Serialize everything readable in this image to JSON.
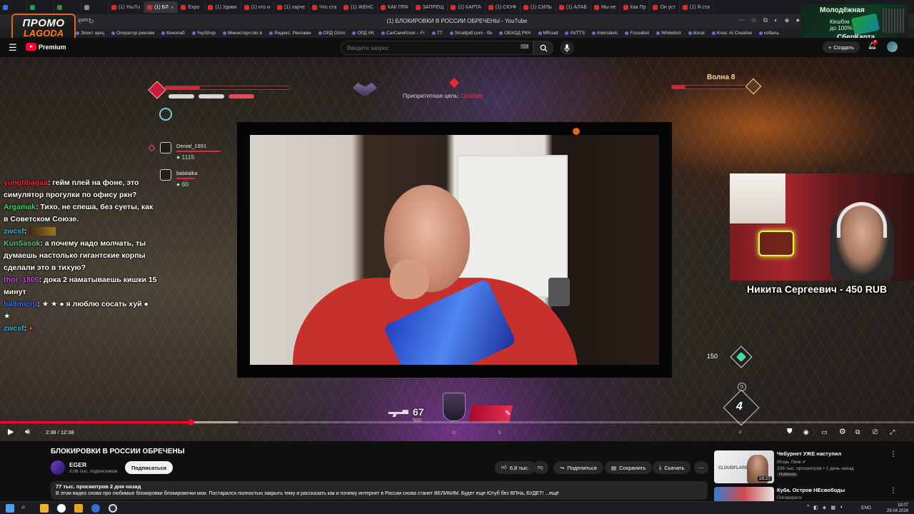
{
  "browser": {
    "tabs": [
      {
        "label": "",
        "active": false
      },
      {
        "label": "",
        "active": false
      },
      {
        "label": "",
        "active": false
      },
      {
        "label": "",
        "active": false
      },
      {
        "label": "(1) YouTu",
        "active": false
      },
      {
        "label": "(1) БЛ",
        "active": true
      },
      {
        "label": "Expo",
        "active": false
      },
      {
        "label": "(1) Удиви",
        "active": false
      },
      {
        "label": "(1) кто и",
        "active": false
      },
      {
        "label": "(1) харче",
        "active": false
      },
      {
        "label": "Что ста",
        "active": false
      },
      {
        "label": "(1) ЖЕНС",
        "active": false
      },
      {
        "label": "КАК ПРА",
        "active": false
      },
      {
        "label": "ЗАПРЕЩ",
        "active": false
      },
      {
        "label": "(1) КАРТА",
        "active": false
      },
      {
        "label": "(1) СКУФ",
        "active": false
      },
      {
        "label": "(1) СИЛЬ",
        "active": false
      },
      {
        "label": "(1) АЛАБ",
        "active": false
      },
      {
        "label": "Мы не",
        "active": false
      },
      {
        "label": "Как Пр",
        "active": false
      },
      {
        "label": "Он уст",
        "active": false
      },
      {
        "label": "(1) Я ста",
        "active": false
      }
    ],
    "window_title": "(1) БЛОКИРОВКИ В РОССИИ ОБРЕЧЕНЫ - YouTube",
    "bookmarks": [
      "Элект аукц",
      "Оператор реклам",
      "Кинопаб",
      "YepShop",
      "Министерство в",
      "Яндекс: Рекламн",
      "ОРД Ozon",
      "ОРД VK",
      "CarCareKiosk – Fr",
      "TT",
      "Smallpdf.com - бе",
      "ОБХОД РКН",
      "MRoad",
      "/N/TTS",
      "Interslavic",
      "Fossabot",
      "Whitebird",
      "donat",
      "Krea: AI Creative",
      "кобаль"
    ]
  },
  "promo": {
    "logo_line1": "ПРОМО",
    "logo_line2": "LAGODA",
    "logo_suffix": ".com",
    "ad_line1": "Молодёжная",
    "ad_line2": "Кешбэк",
    "ad_line3": "до 100%",
    "ad_line4": "СберКарта"
  },
  "youtube": {
    "logo_text": "Premium",
    "search_placeholder": "Введите запрос",
    "create_label": "Создать",
    "notif_count": "9"
  },
  "game_hud": {
    "priority_label": "Приоритетная цель:",
    "priority_value": "Особая",
    "wave_label": "Волна 8",
    "players": [
      {
        "name": "Denial_1991",
        "score": "1115"
      },
      {
        "name": "balalaika",
        "score": "60"
      }
    ],
    "ammo": "67",
    "ammo_max": "500",
    "slot_number": "150",
    "counter": "0",
    "big_number": "4",
    "keys": [
      "G",
      "5",
      "F"
    ]
  },
  "chat": [
    {
      "nick": "yungtibagaa",
      "color": "#e8253a",
      "text": "гейм плей на фоне, это симулятор прогулки по офису ркн?"
    },
    {
      "nick": "Argamak",
      "color": "#41d16a",
      "text": "Тихо, не спеша, без суеты, как в Советском Союзе."
    },
    {
      "nick": "zwcsf",
      "color": "#36b3d6",
      "text": ""
    },
    {
      "nick": "KunSasok",
      "color": "#41d16a",
      "text": "а почему надо молчать, ты думаешь настолько гигантские корпы сделали это в тихую?"
    },
    {
      "nick": "thor_1805",
      "color": "#b94cd9",
      "text": "дока 2 наматываешь кишки 15 минут"
    },
    {
      "nick": "badmicrp",
      "color": "#3b6df0",
      "text": "★ ★ ● я люблю сосать хуй ● ★"
    },
    {
      "nick": "zwcsf",
      "color": "#36b3d6",
      "text": "●"
    }
  ],
  "donation_alert": "Никита Сергеевич - 450 RUB",
  "player": {
    "time_current": "2:38",
    "time_total": "12:38",
    "progress": 0.2084,
    "buffered": 0.26
  },
  "video": {
    "title": "БЛОКИРОВКИ В РОССИИ ОБРЕЧЕНЫ",
    "channel": "EGER",
    "subscribers": "3,06 тыс. подписчиков",
    "subscribe_label": "Подписаться",
    "likes": "6,8 тыс.",
    "share_label": "Поделиться",
    "save_label": "Сохранить",
    "download_label": "Скачать",
    "views_date": "77 тыс. просмотров  2 дня назад",
    "description": "В этом видео снова про любимые блокировки блокировочки мои. Постарался полностью закрыть тему и рассказать как и почему интернет в России снова станет ВЕЛИКИМ. Будет еще Ютуб без ВПНа, БУДЕТ! ...ещё"
  },
  "recommendations": [
    {
      "title": "Чебурнет УЖЕ наступил",
      "channel": "Игорь Линк ✔",
      "meta": "338 тыс. просмотров • 1 день назад",
      "badge": "Новинка",
      "duration": "18:27"
    },
    {
      "title": "Куба. Остров НЕсвободы",
      "channel": "Поговорите",
      "meta": "",
      "badge": "",
      "duration": ""
    }
  ],
  "taskbar": {
    "lang": "ENG",
    "time": "18:07",
    "date": "29.04.2026"
  },
  "colors": {
    "yt_red": "#ff0033",
    "hud_red": "#e21f3a",
    "hud_gold": "#f1d9a0"
  }
}
